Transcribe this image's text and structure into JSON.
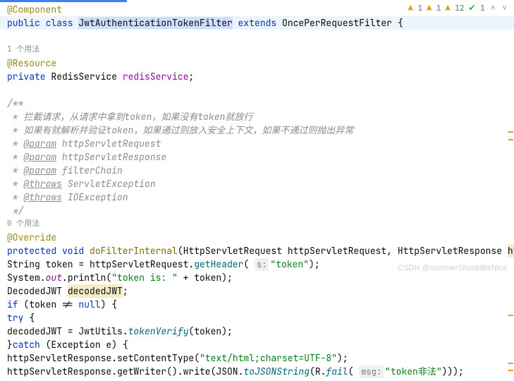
{
  "topbar": {
    "warn1": "1",
    "warn2": "1",
    "warn3": "12",
    "check": "1"
  },
  "code": {
    "l1_anno": "@Component",
    "l2_pre": "public class ",
    "l2_name": "JwtAuthenticationTokenFilter",
    "l2_ext": " extends ",
    "l2_sup": "OncePerRequestFilter",
    "l2_brace": " {",
    "l4_usage": "1 个用法",
    "l5_anno": "@Resource",
    "l6_priv": "private ",
    "l6_type": "RedisService ",
    "l6_field": "redisService",
    "l6_end": ";",
    "c_open": "/**",
    "c_1": " * 拦截请求，从请求中拿到token，如果没有token就放行",
    "c_2": " * 如果有就解析并验证token，如果通过则放入安全上下文，如果不通过则抛出异常",
    "c_3a": " * ",
    "c_param": "@param",
    "c_throws": "@throws",
    "c_p1": " httpServletRequest",
    "c_p2": " httpServletResponse",
    "c_p3": " filterChain",
    "c_t1": " ServletException",
    "c_t2": " IOException",
    "c_close": " */",
    "u0": "0 个用法",
    "ov": "@Override",
    "m_pre": "protected void ",
    "m_name": "doFilterInternal",
    "m_args": "(HttpServletRequest httpServletRequest, HttpServletResponse ",
    "m_arg_last": "httpServletRespon",
    "b1_a": "String token = httpServletRequest.",
    "b1_m": "getHeader",
    "b1_p": "( ",
    "b1_hint": "s:",
    "b1_s": "\"token\"",
    "b1_e": ");",
    "b2_a": "System.",
    "b2_out": "out",
    "b2_b": ".println(",
    "b2_s": "\"token is: \"",
    "b2_c": " + token);",
    "b3_a": "DecodedJWT ",
    "b3_v": "decodedJWT",
    "b3_e": ";",
    "b4_if": "if ",
    "b4_c": "(token != ",
    "b4_null": "null",
    "b4_e": ") {",
    "b5_try": "try ",
    "b5_e": "{",
    "b6_a": "decodedJWT = JwtUtils.",
    "b6_m": "tokenVerify",
    "b6_e": "(token);",
    "b7_a": "}",
    "b7_catch": "catch ",
    "b7_b": "(Exception e) {",
    "b8_a": "httpServletResponse.setContentType(",
    "b8_s": "\"text/html;charset=UTF-8\"",
    "b8_e": ");",
    "b9_a": "httpServletResponse.getWriter().write(JSON.",
    "b9_m": "toJSONString",
    "b9_b": "(R.",
    "b9_m2": "fail",
    "b9_c": "( ",
    "b9_hint": "msg:",
    "b9_s": "\"token非法\"",
    "b9_e": ")));"
  },
  "watermark": "CSDN @summerShouldBeNice"
}
